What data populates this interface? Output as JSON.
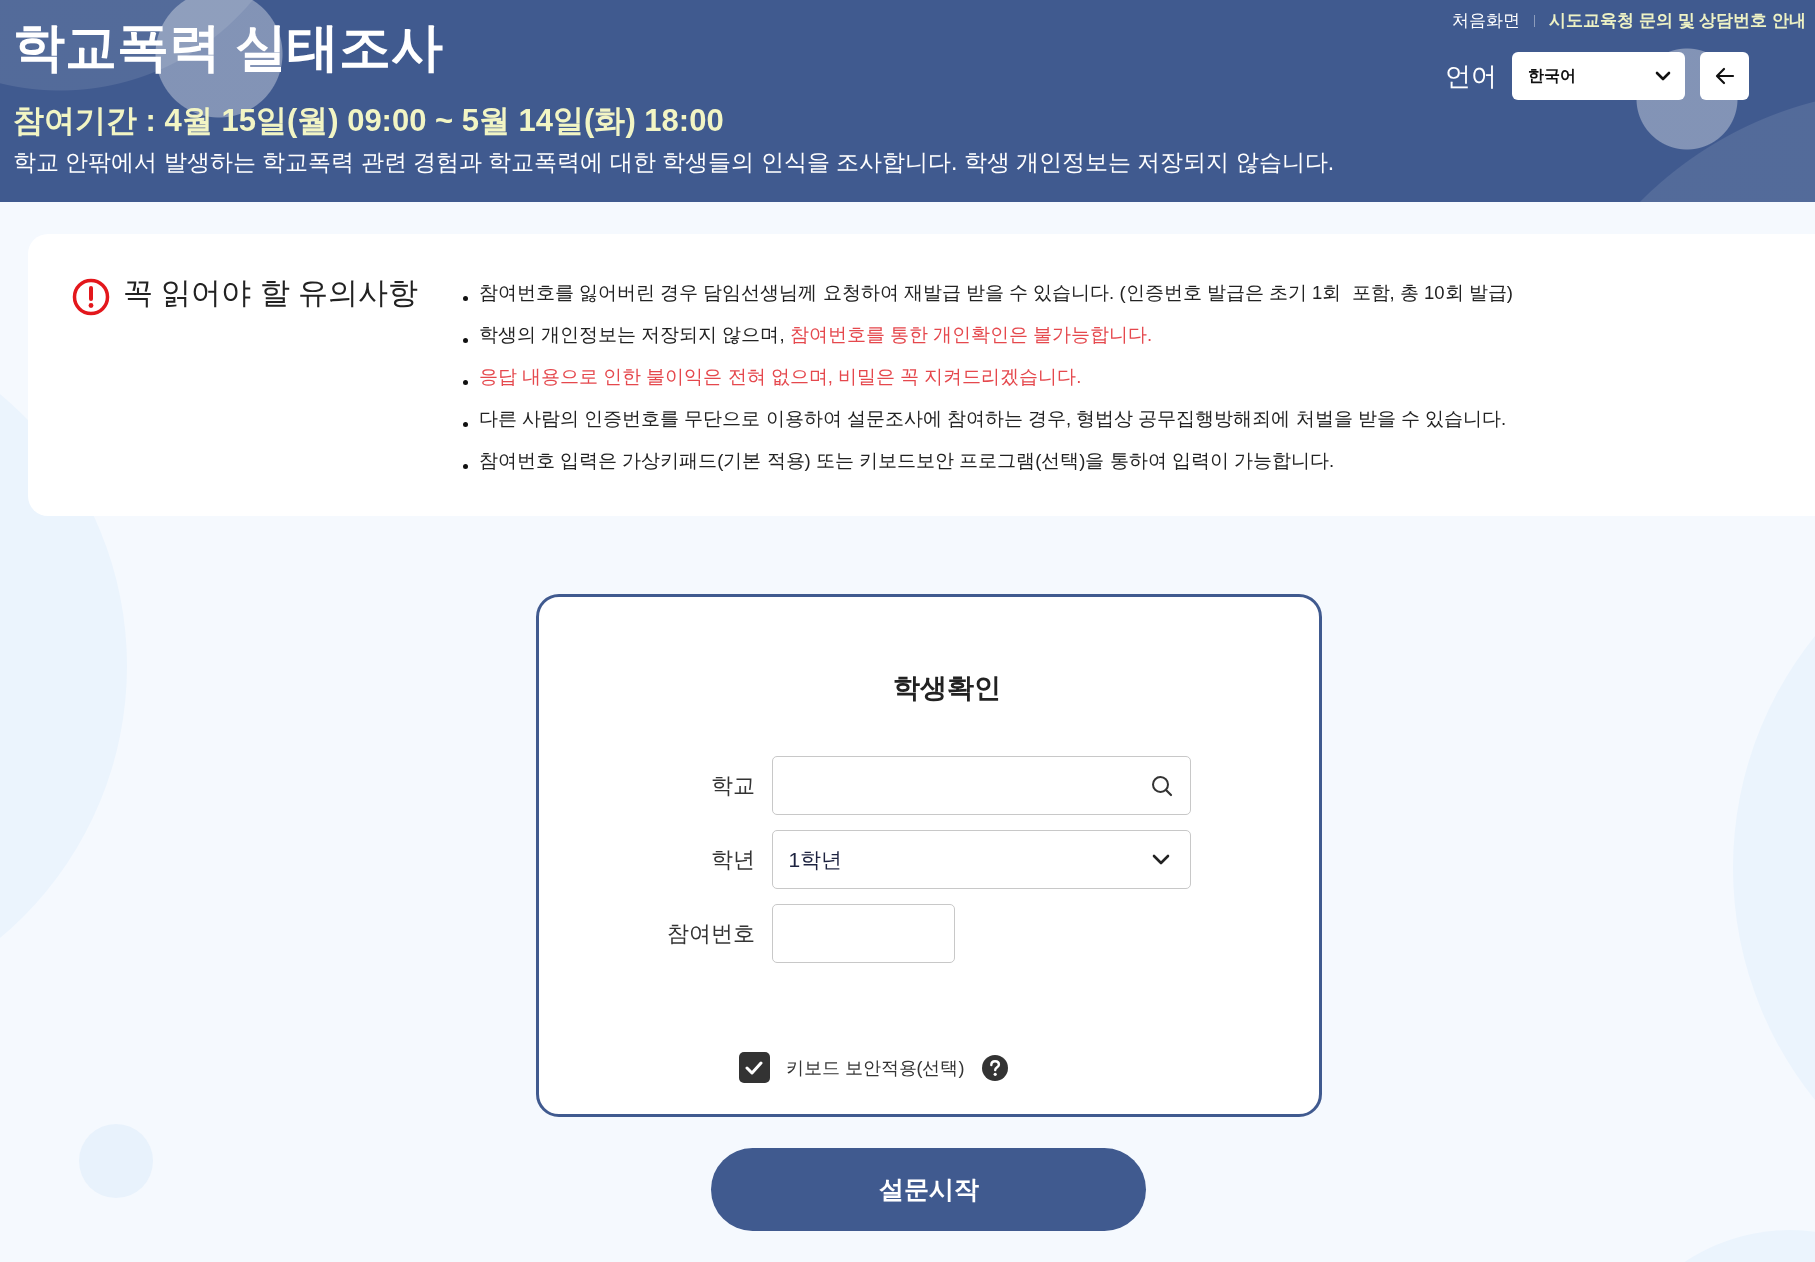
{
  "header": {
    "title": "학교폭력 실태조사",
    "period": "참여기간 : 4월 15일(월) 09:00 ~ 5월 14일(화) 18:00",
    "description": "학교 안팎에서 발생하는 학교폭력 관련 경험과 학교폭력에 대한 학생들의 인식을 조사합니다. 학생 개인정보는 저장되지 않습니다.",
    "links": [
      {
        "label": "처음화면",
        "emphasis": false
      },
      {
        "label": "시도교육청 문의 및 상담번호 안내",
        "emphasis": true
      }
    ],
    "language": {
      "label": "언어",
      "value": "한국어"
    }
  },
  "notice": {
    "title": "꼭 읽어야 할 유의사항",
    "items": [
      {
        "parts": [
          {
            "text": "참여번호를 잃어버린 경우 담임선생님께 요청하여 재발급 받을 수 있습니다. (인증번호 발급은 초기 1회  포함, 총 10회 발급)",
            "emphasis": false
          }
        ]
      },
      {
        "parts": [
          {
            "text": "학생의 개인정보는 저장되지 않으며, ",
            "emphasis": false
          },
          {
            "text": "참여번호를 통한 개인확인은 불가능합니다.",
            "emphasis": true
          }
        ]
      },
      {
        "parts": [
          {
            "text": "응답 내용으로 인한 불이익은 전혀 없으며, 비밀은 꼭 지켜드리겠습니다.",
            "emphasis": true
          }
        ]
      },
      {
        "parts": [
          {
            "text": "다른 사람의 인증번호를 무단으로 이용하여 설문조사에 참여하는 경우, 형법상 공무집행방해죄에 처벌을 받을 수 있습니다.",
            "emphasis": false
          }
        ]
      },
      {
        "parts": [
          {
            "text": "참여번호 입력은 가상키패드(기본 적용) 또는 키보드보안 프로그램(선택)을 통하여 입력이 가능합니다.",
            "emphasis": false
          }
        ]
      }
    ]
  },
  "form": {
    "title": "학생확인",
    "fields": [
      {
        "kind": "search",
        "label": "학교"
      },
      {
        "kind": "select",
        "label": "학년",
        "value": "1학년"
      },
      {
        "kind": "text",
        "label": "참여번호"
      }
    ],
    "keyboard_security": {
      "label": "키보드 보안적용(선택)",
      "checked": true
    }
  },
  "start_button": {
    "label": "설문시작"
  }
}
